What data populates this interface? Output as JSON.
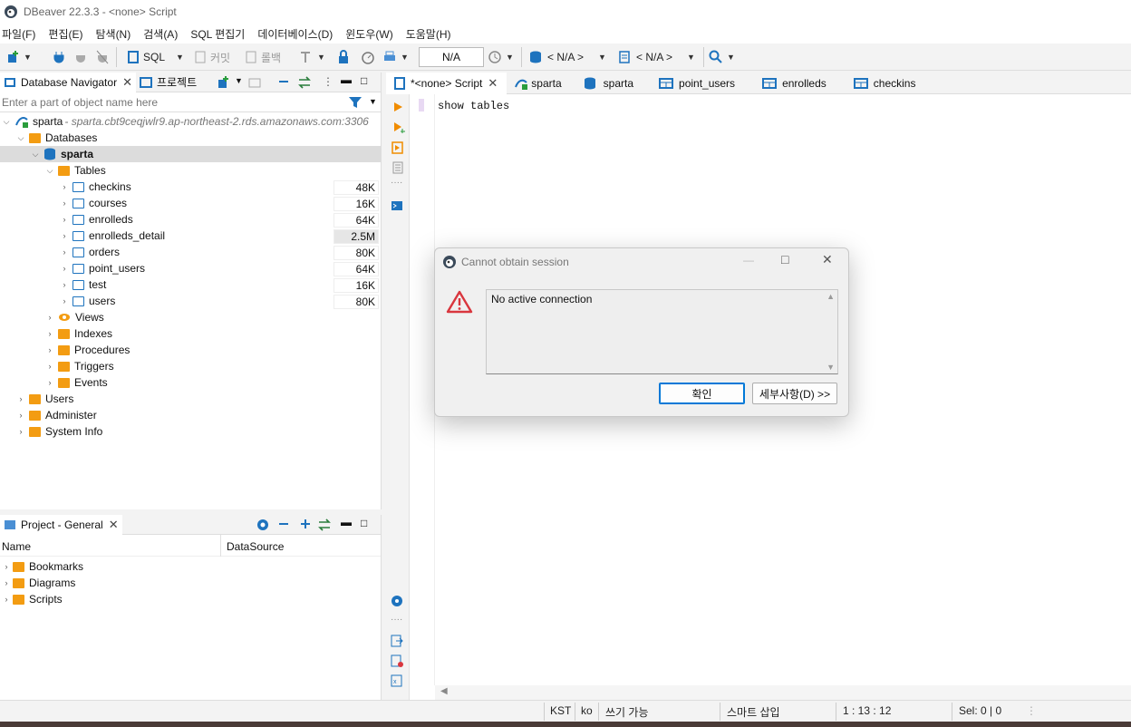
{
  "app": {
    "title": "DBeaver 22.3.3 - <none> Script"
  },
  "menu": [
    "파일(F)",
    "편집(E)",
    "탐색(N)",
    "검색(A)",
    "SQL 편집기",
    "데이터베이스(D)",
    "윈도우(W)",
    "도움말(H)"
  ],
  "toolbar": {
    "sql_label": "SQL",
    "commit_label": "커밋",
    "rollback_label": "롤백",
    "transaction_mode": "N/A",
    "datasource_selector": "< N/A >",
    "schema_selector": "< N/A >"
  },
  "navigator": {
    "tab_label": "Database Navigator",
    "tab2_label": "프로젝트",
    "filter_placeholder": "Enter a part of object name here",
    "connection": {
      "name": "sparta",
      "url": " - sparta.cbt9ceqjwlr9.ap-northeast-2.rds.amazonaws.com:3306"
    },
    "databases_label": "Databases",
    "schema": "sparta",
    "tables_label": "Tables",
    "tables": [
      {
        "name": "checkins",
        "size": "48K"
      },
      {
        "name": "courses",
        "size": "16K"
      },
      {
        "name": "enrolleds",
        "size": "64K"
      },
      {
        "name": "enrolleds_detail",
        "size": "2.5M"
      },
      {
        "name": "orders",
        "size": "80K"
      },
      {
        "name": "point_users",
        "size": "64K"
      },
      {
        "name": "test",
        "size": "16K"
      },
      {
        "name": "users",
        "size": "80K"
      }
    ],
    "folders": [
      "Views",
      "Indexes",
      "Procedures",
      "Triggers",
      "Events"
    ],
    "root_items": [
      "Users",
      "Administer",
      "System Info"
    ]
  },
  "project": {
    "tab_label": "Project - General",
    "col_name": "Name",
    "col_datasource": "DataSource",
    "items": [
      "Bookmarks",
      "Diagrams",
      "Scripts"
    ]
  },
  "editor": {
    "tabs": [
      "*<none> Script",
      "sparta",
      "sparta",
      "point_users",
      "enrolleds",
      "checkins"
    ],
    "code": "show tables"
  },
  "dialog": {
    "title": "Cannot obtain session",
    "message": "No active connection",
    "ok_label": "확인",
    "details_label": "세부사항(D) >>"
  },
  "status": {
    "tz": "KST",
    "locale": "ko",
    "mode": "쓰기 가능",
    "insert": "스마트 삽입",
    "position": "1 : 13 : 12",
    "selection": "Sel: 0 | 0"
  },
  "colors": {
    "accent": "#1e73be",
    "folder": "#f39c12",
    "run": "#f08c00",
    "error": "#d9363e"
  }
}
